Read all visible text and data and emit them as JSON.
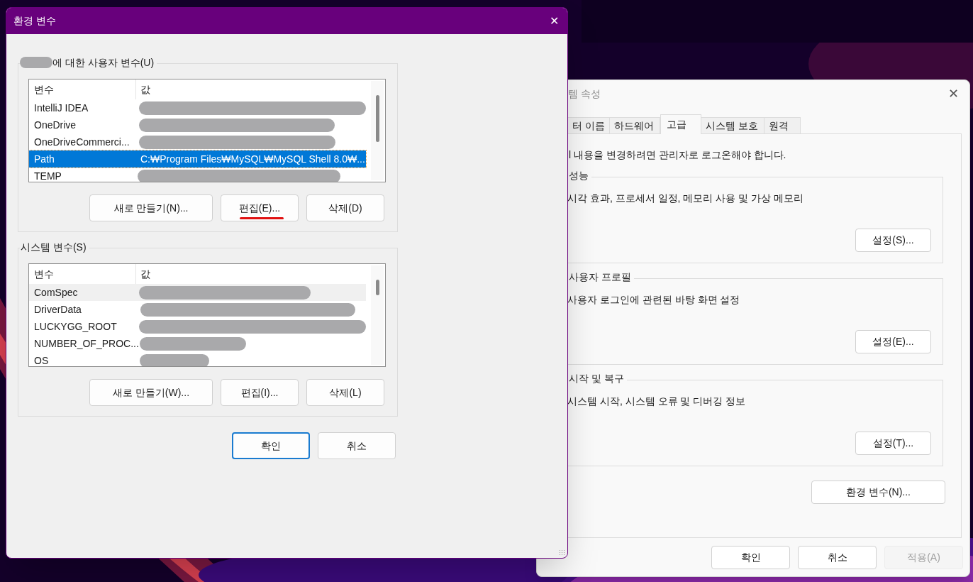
{
  "env_dialog": {
    "title": "환경 변수",
    "close": "✕",
    "user_vars": {
      "label_suffix": "에 대한 사용자 변수(U)",
      "owner_redacted": true,
      "columns": [
        "변수",
        "값"
      ],
      "rows": [
        {
          "name": "IntelliJ IDEA",
          "redacted": true,
          "selected": false
        },
        {
          "name": "OneDrive",
          "redacted": true,
          "selected": false
        },
        {
          "name": "OneDriveCommerci...",
          "redacted": true,
          "selected": false
        },
        {
          "name": "Path",
          "value": "C:₩Program Files₩MySQL₩MySQL Shell 8.0₩...",
          "redacted": false,
          "selected": true
        },
        {
          "name": "TEMP",
          "redacted": true,
          "selected": false
        }
      ],
      "buttons": [
        {
          "label": "새로 만들기(N)...",
          "marked": false
        },
        {
          "label": "편집(E)...",
          "marked": true
        },
        {
          "label": "삭제(D)",
          "marked": false
        }
      ]
    },
    "system_vars": {
      "label": "시스템 변수(S)",
      "columns": [
        "변수",
        "값"
      ],
      "rows": [
        {
          "name": "ComSpec",
          "redacted": true,
          "selected": false,
          "hover": true
        },
        {
          "name": "DriverData",
          "redacted": true,
          "selected": false,
          "hover": false
        },
        {
          "name": "LUCKYGG_ROOT",
          "redacted": true,
          "selected": false,
          "hover": false
        },
        {
          "name": "NUMBER_OF_PROC...",
          "redacted": true,
          "selected": false,
          "hover": false
        },
        {
          "name": "OS",
          "redacted": true,
          "selected": false,
          "hover": false
        }
      ],
      "buttons": [
        {
          "label": "새로 만들기(W)...",
          "marked": false
        },
        {
          "label": "편집(I)...",
          "marked": false
        },
        {
          "label": "삭제(L)",
          "marked": false
        }
      ]
    },
    "footer_buttons": [
      {
        "label": "확인",
        "default": true
      },
      {
        "label": "취소",
        "default": false
      }
    ]
  },
  "system_properties": {
    "title": "템 속성",
    "close": "✕",
    "tabs": [
      {
        "label": "터 이름",
        "selected": false
      },
      {
        "label": "하드웨어",
        "selected": false
      },
      {
        "label": "고급",
        "selected": true
      },
      {
        "label": "시스템 보호",
        "selected": false
      },
      {
        "label": "원격",
        "selected": false
      }
    ],
    "notice": "l 내용을 변경하려면 관리자로 로그온해야 합니다.",
    "groups": [
      {
        "title": "성능",
        "description": "시각 효과, 프로세서 일정, 메모리 사용 및 가상 메모리",
        "button": "설정(S)..."
      },
      {
        "title": "사용자 프로필",
        "description": "사용자 로그인에 관련된 바탕 화면 설정",
        "button": "설정(E)..."
      },
      {
        "title": "시작 및 복구",
        "description": "시스템 시작, 시스템 오류 및 디버깅 정보",
        "button": "설정(T)..."
      }
    ],
    "env_button": "환경 변수(N)...",
    "footer_buttons": [
      {
        "label": "확인",
        "disabled": false
      },
      {
        "label": "취소",
        "disabled": false
      },
      {
        "label": "적용(A)",
        "disabled": true
      }
    ]
  }
}
